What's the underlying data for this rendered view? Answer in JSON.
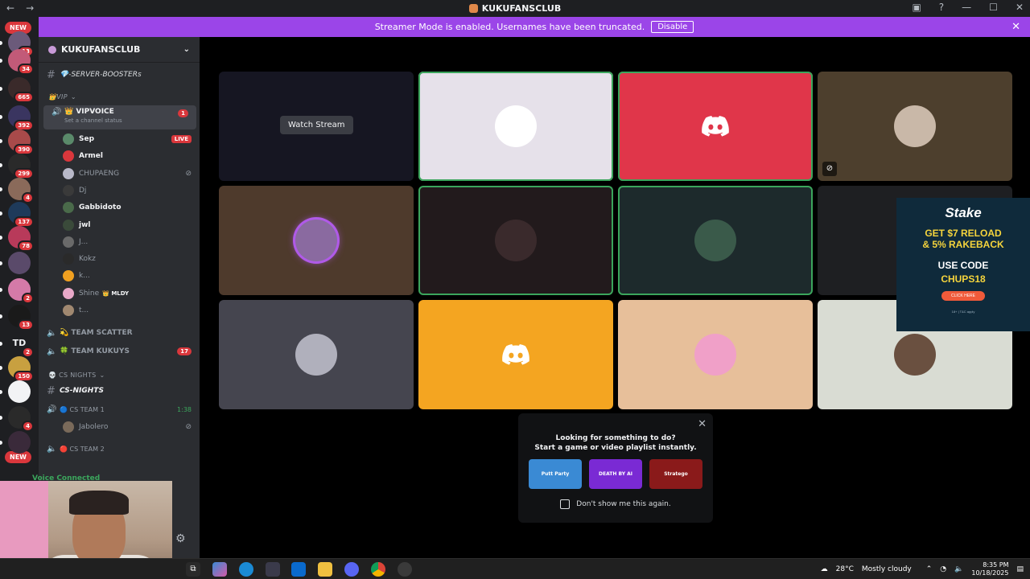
{
  "window": {
    "title": "KUKUFANSCLUB"
  },
  "banner": {
    "text": "Streamer Mode is enabled. Usernames have been truncated.",
    "button": "Disable"
  },
  "guilds": {
    "new_top": "NEW",
    "new_bottom": "NEW",
    "items": [
      {
        "badge": "13",
        "color": "#6b5a7a"
      },
      {
        "badge": "34",
        "color": "#c25a78"
      },
      {
        "badge": "665",
        "color": "#3a2a2a"
      },
      {
        "badge": "392",
        "color": "#3a3560"
      },
      {
        "badge": "390",
        "color": "#a84a4a"
      },
      {
        "badge": "299",
        "color": "#2a2a2a"
      },
      {
        "badge": "4",
        "color": "#8a6a5a"
      },
      {
        "badge": "137",
        "color": "#1e3a5a"
      },
      {
        "badge": "78",
        "color": "#b83a5a"
      },
      {
        "badge": "",
        "color": "#5a4a6a"
      },
      {
        "badge": "2",
        "color": "#d47aa8"
      },
      {
        "badge": "13",
        "color": "#1a1a1a"
      },
      {
        "badge": "2",
        "color": "#1e1f22",
        "text": "TD"
      },
      {
        "badge": "150",
        "color": "#c8a040"
      },
      {
        "badge": "",
        "color": "#f2f3f5"
      },
      {
        "badge": "4",
        "color": "#2a2a2a"
      },
      {
        "badge": "",
        "color": "#3a2a3a"
      }
    ]
  },
  "sidebar": {
    "server_name": "KUKUFANSCLUB",
    "channel_boosters": "💎-SERVER-BOOSTERs",
    "cat_vip": "👑VIP",
    "vipvoice": {
      "name": "👑 VIPVOICE",
      "status": "Set a channel status",
      "count": "1"
    },
    "users": [
      {
        "name": "Sep",
        "tag": "LIVE",
        "active": true,
        "color": "#5a8a6a"
      },
      {
        "name": "Armel",
        "active": true,
        "color": "#da373c"
      },
      {
        "name": "CHUPAENG",
        "muted": true,
        "color": "#b8b8c8"
      },
      {
        "name": "Dj",
        "color": "#3a3a3a"
      },
      {
        "name": "Gabbidoto",
        "active": true,
        "color": "#4a6a4a"
      },
      {
        "name": "jwl",
        "active": true,
        "color": "#3a4a3a"
      },
      {
        "name": "J...",
        "color": "#6a6a6a"
      },
      {
        "name": "Kokz",
        "color": "#2a2a2a"
      },
      {
        "name": "k...",
        "color": "#f0a020"
      },
      {
        "name": "Shine",
        "extra": "👑 MLDY",
        "color": "#e8a8c8"
      },
      {
        "name": "t...",
        "color": "#a08870"
      }
    ],
    "team_scatter": "💫 TEAM SCATTER",
    "team_kukuys": "🍀 TEAM KUKUYS",
    "team_kukuys_count": "17",
    "cat_csnights": "💀 CS NIGHTS",
    "cs_nights_channel": "CS-NIGHTS",
    "cs_team1": "🔵 CS TEAM 1",
    "cs_team1_time": "1:38",
    "cs_team1_user": "Jabolero",
    "cs_team2": "🔴 CS TEAM 2",
    "voice_connected": "Voice Connected"
  },
  "grid": {
    "watch_stream": "Watch Stream",
    "tiles": [
      {
        "bg": "#161622",
        "type": "stream"
      },
      {
        "bg": "#e6e1ea",
        "type": "avatar",
        "avatar": "#ffffff",
        "speaking": true
      },
      {
        "bg": "#e0364a",
        "type": "discord",
        "speaking": true
      },
      {
        "bg": "#4d3f2d",
        "type": "avatar",
        "avatar": "#c9b8a8",
        "muted": true
      },
      {
        "bg": "#4e3a2c",
        "type": "avatar",
        "avatar": "#8a6aa0",
        "ring": true
      },
      {
        "bg": "#221a1c",
        "type": "avatar",
        "avatar": "#3a2a2c",
        "speaking": true
      },
      {
        "bg": "#1d2a2c",
        "type": "avatar",
        "avatar": "#3a5a4a",
        "speaking": true
      },
      {
        "bg": "#1e1f22",
        "type": "empty"
      },
      {
        "bg": "#45454f",
        "type": "avatar",
        "avatar": "#b0b0bc"
      },
      {
        "bg": "#f4a521",
        "type": "discord"
      },
      {
        "bg": "#e7bf9a",
        "type": "avatar",
        "avatar": "#f0a0c8"
      },
      {
        "bg": "#d9dcd3",
        "type": "avatar",
        "avatar": "#6a5040"
      }
    ]
  },
  "ad": {
    "brand": "Stake",
    "line1": "GET $7 RELOAD",
    "line1b": "& 5% RAKEBACK",
    "line2": "USE CODE",
    "line3": "CHUPS18",
    "cta": "CLICK HERE",
    "fine": "18+ | T&C apply"
  },
  "popup": {
    "line1": "Looking for something to do?",
    "line2": "Start a game or video playlist instantly.",
    "checkbox": "Don't show me this again.",
    "games": [
      {
        "label": "Putt Party",
        "color": "#3a8ad4"
      },
      {
        "label": "DEATH BY AI",
        "color": "#7a2ad4"
      },
      {
        "label": "Stratego",
        "color": "#8a1a1a"
      }
    ]
  },
  "taskbar": {
    "weather_temp": "28°C",
    "weather_text": "Mostly cloudy",
    "time": "8:35 PM",
    "date": "10/18/2025"
  }
}
